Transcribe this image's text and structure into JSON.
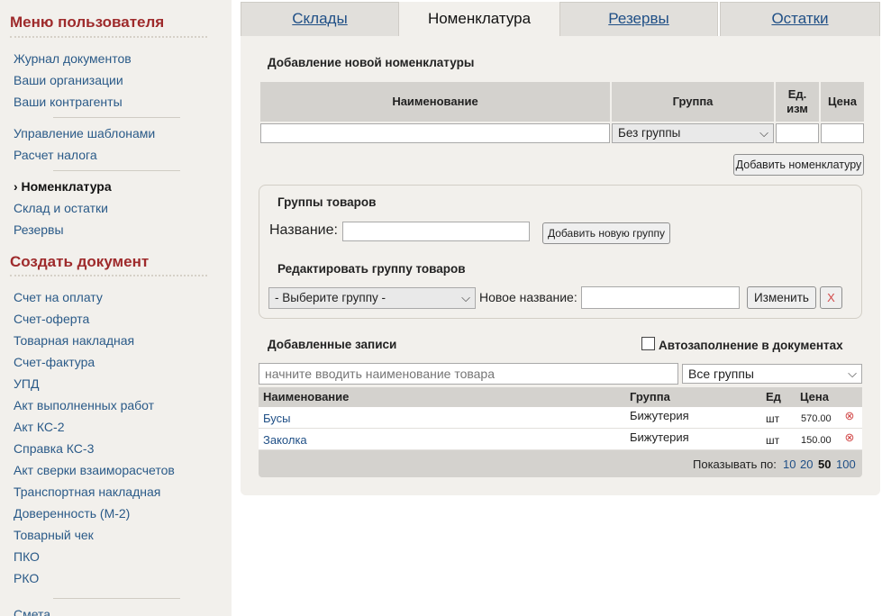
{
  "sidebar": {
    "menu_title": "Меню пользователя",
    "menu_items": [
      {
        "label": "Журнал документов"
      },
      {
        "label": "Ваши организации"
      },
      {
        "label": "Ваши контрагенты"
      },
      {
        "label": "Управление шаблонами"
      },
      {
        "label": "Расчет налога"
      },
      {
        "label": "› Номенклатура",
        "active": true
      },
      {
        "label": "Склад и остатки"
      },
      {
        "label": "Резервы"
      }
    ],
    "create_title": "Создать документ",
    "create_items": [
      {
        "label": "Счет на оплату"
      },
      {
        "label": "Счет-оферта"
      },
      {
        "label": "Товарная накладная"
      },
      {
        "label": "Счет-фактура"
      },
      {
        "label": "УПД"
      },
      {
        "label": "Акт выполненных работ"
      },
      {
        "label": "Акт КС-2"
      },
      {
        "label": "Справка КС-3"
      },
      {
        "label": "Акт сверки взаиморасчетов"
      },
      {
        "label": "Транспортная накладная"
      },
      {
        "label": "Доверенность (М-2)"
      },
      {
        "label": "Товарный чек"
      },
      {
        "label": "ПКО"
      },
      {
        "label": "РКО"
      },
      {
        "label": "Смета"
      }
    ]
  },
  "tabs": [
    {
      "label": "Склады",
      "active": false
    },
    {
      "label": "Номенклатура",
      "active": true
    },
    {
      "label": "Резервы",
      "active": false
    },
    {
      "label": "Остатки",
      "active": false
    }
  ],
  "add_form": {
    "title": "Добавление новой номенклатуры",
    "col_name": "Наименование",
    "col_group": "Группа",
    "col_unit_l1": "Ед.",
    "col_unit_l2": "изм",
    "col_price": "Цена",
    "name_value": "",
    "group_value": "Без группы",
    "unit_value": "",
    "price_value": "",
    "add_button": "Добавить номенклатуру"
  },
  "groups": {
    "title": "Группы товаров",
    "name_label": "Название:",
    "name_value": "",
    "add_group_button": "Добавить новую группу",
    "edit_title": "Редактировать группу товаров",
    "select_value": "- Выберите группу -",
    "new_name_label": "Новое название:",
    "new_name_value": "",
    "change_button": "Изменить",
    "delete_button": "X"
  },
  "records": {
    "title": "Добавленные записи",
    "autofill_label": "Автозаполнение в документах",
    "autofill_checked": false,
    "search_placeholder": "начните вводить наименование товара",
    "filter_value": "Все группы",
    "headers": {
      "name": "Наименование",
      "group": "Группа",
      "unit": "Ед",
      "price": "Цена"
    },
    "rows": [
      {
        "name": "Бусы",
        "group": "Бижутерия",
        "unit": "шт",
        "price": "570.00"
      },
      {
        "name": "Заколка",
        "group": "Бижутерия",
        "unit": "шт",
        "price": "150.00"
      }
    ],
    "show_label": "Показывать по:",
    "page_sizes": [
      "10",
      "20",
      "50",
      "100"
    ],
    "current_page_size": "50"
  },
  "colors": {
    "accent_heading": "#9e2a2b",
    "link": "#2a5a88",
    "delete_icon": "#d24b4b"
  },
  "icons": {
    "dropdown": "chevron-down-icon",
    "remove": "circle-x-icon",
    "checkbox": "checkbox-icon"
  }
}
